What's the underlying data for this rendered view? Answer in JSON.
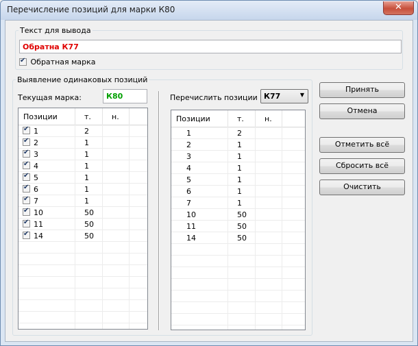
{
  "window": {
    "title": "Перечисление позиций для марки К80",
    "close_glyph": "✕"
  },
  "output_group": {
    "legend": "Текст для вывода",
    "text_value": "Обратна К77",
    "text_color": "#e00000",
    "reverse_checkbox": {
      "label": "Обратная марка",
      "checked": true
    }
  },
  "identical_group": {
    "legend": "Выявление одинаковых позиций",
    "current_mark_label": "Текущая марка:",
    "current_mark_value": "К80",
    "current_mark_color": "#00a000",
    "enumerate_label": "Перечислить позиции по:",
    "enumerate_selected": "К77"
  },
  "left_list": {
    "headers": [
      "Позиции",
      "т.",
      "н."
    ],
    "rows": [
      {
        "pos": "1",
        "t": "2",
        "n": "",
        "checked": true
      },
      {
        "pos": "2",
        "t": "1",
        "n": "",
        "checked": true
      },
      {
        "pos": "3",
        "t": "1",
        "n": "",
        "checked": true
      },
      {
        "pos": "4",
        "t": "1",
        "n": "",
        "checked": true
      },
      {
        "pos": "5",
        "t": "1",
        "n": "",
        "checked": true
      },
      {
        "pos": "6",
        "t": "1",
        "n": "",
        "checked": true
      },
      {
        "pos": "7",
        "t": "1",
        "n": "",
        "checked": true
      },
      {
        "pos": "10",
        "t": "50",
        "n": "",
        "checked": true
      },
      {
        "pos": "11",
        "t": "50",
        "n": "",
        "checked": true
      },
      {
        "pos": "14",
        "t": "50",
        "n": "",
        "checked": true
      }
    ]
  },
  "right_list": {
    "headers": [
      "Позиции",
      "т.",
      "н."
    ],
    "rows": [
      {
        "pos": "1",
        "t": "2",
        "n": ""
      },
      {
        "pos": "2",
        "t": "1",
        "n": ""
      },
      {
        "pos": "3",
        "t": "1",
        "n": ""
      },
      {
        "pos": "4",
        "t": "1",
        "n": ""
      },
      {
        "pos": "5",
        "t": "1",
        "n": ""
      },
      {
        "pos": "6",
        "t": "1",
        "n": ""
      },
      {
        "pos": "7",
        "t": "1",
        "n": ""
      },
      {
        "pos": "10",
        "t": "50",
        "n": ""
      },
      {
        "pos": "11",
        "t": "50",
        "n": ""
      },
      {
        "pos": "14",
        "t": "50",
        "n": ""
      }
    ]
  },
  "buttons": {
    "accept": "Принять",
    "cancel": "Отмена",
    "check_all": "Отметить всё",
    "reset_all": "Сбросить всё",
    "clear": "Очистить"
  }
}
